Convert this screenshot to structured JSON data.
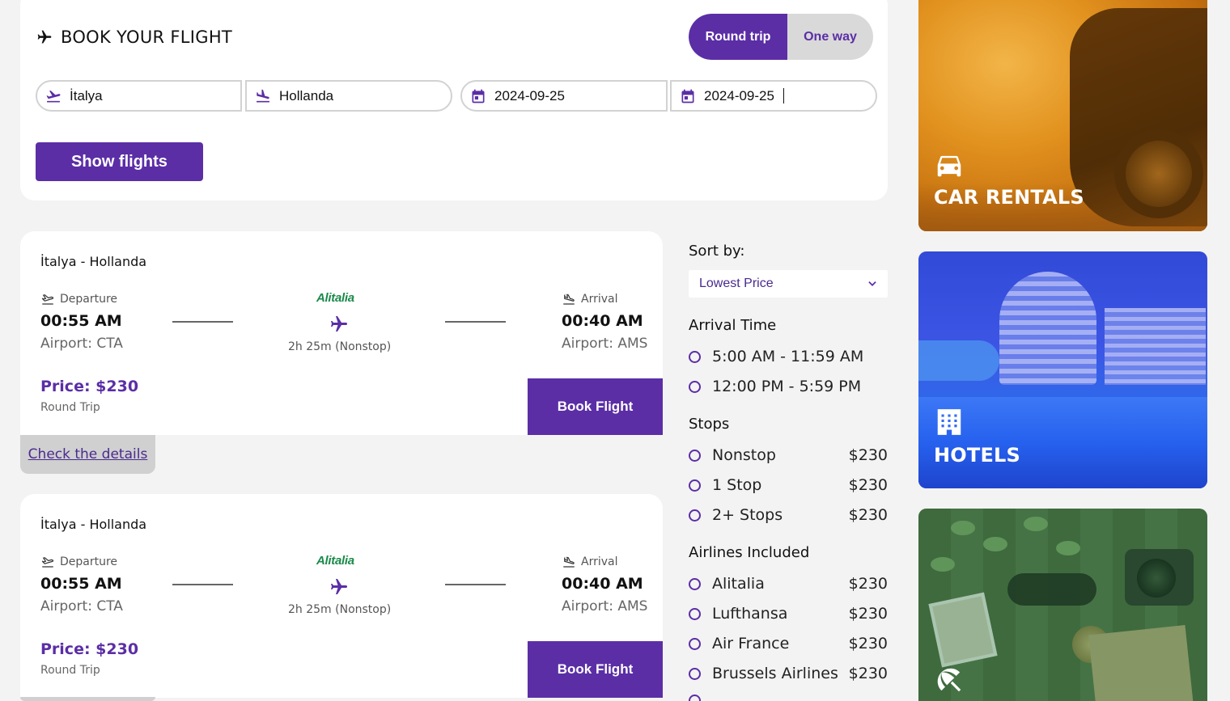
{
  "booking": {
    "title": "BOOK YOUR FLIGHT",
    "trip_toggle": {
      "round_trip": "Round trip",
      "one_way": "One way",
      "selected": "Round trip"
    },
    "from": "İtalya",
    "to": "Hollanda",
    "departure_date": "2024-09-25",
    "return_date": "2024-09-25",
    "show_button": "Show flights",
    "accent_color": "#5b2ea6"
  },
  "flights": [
    {
      "route": "İtalya - Hollanda",
      "departure_label": "Departure",
      "departure_time": "00:55 AM",
      "departure_airport": "Airport: CTA",
      "airline": "Alitalia",
      "duration": "2h 25m (Nonstop)",
      "arrival_label": "Arrival",
      "arrival_time": "00:40 AM",
      "arrival_airport": "Airport: AMS",
      "price": "Price: $230",
      "trip_type": "Round Trip",
      "book_button": "Book Flight",
      "details_link": "Check the details"
    },
    {
      "route": "İtalya - Hollanda",
      "departure_label": "Departure",
      "departure_time": "00:55 AM",
      "departure_airport": "Airport: CTA",
      "airline": "Alitalia",
      "duration": "2h 25m (Nonstop)",
      "arrival_label": "Arrival",
      "arrival_time": "00:40 AM",
      "arrival_airport": "Airport: AMS",
      "price": "Price: $230",
      "trip_type": "Round Trip",
      "book_button": "Book Flight"
    }
  ],
  "filters": {
    "sort_label": "Sort by:",
    "sort_value": "Lowest Price",
    "arrival_time": {
      "heading": "Arrival Time",
      "options": [
        "5:00 AM - 11:59 AM",
        "12:00 PM - 5:59 PM"
      ]
    },
    "stops": {
      "heading": "Stops",
      "options": [
        {
          "label": "Nonstop",
          "price": "$230"
        },
        {
          "label": "1 Stop",
          "price": "$230"
        },
        {
          "label": "2+ Stops",
          "price": "$230"
        }
      ]
    },
    "airlines": {
      "heading": "Airlines Included",
      "options": [
        {
          "label": "Alitalia",
          "price": "$230"
        },
        {
          "label": "Lufthansa",
          "price": "$230"
        },
        {
          "label": "Air France",
          "price": "$230"
        },
        {
          "label": "Brussels Airlines",
          "price": "$230"
        }
      ]
    }
  },
  "promos": {
    "car": {
      "label": "CAR RENTALS",
      "icon": "car-icon"
    },
    "hotel": {
      "label": "HOTELS",
      "icon": "hotel-icon"
    },
    "travel": {
      "icon": "beach-umbrella-icon"
    }
  }
}
